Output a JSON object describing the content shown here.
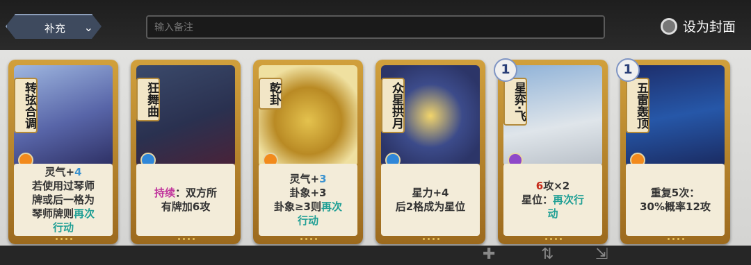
{
  "header": {
    "deck_label": "补充",
    "note_placeholder": "输入备注",
    "cover_label": "设为封面"
  },
  "cards": [
    {
      "name": "转弦合调",
      "gem_color": "#f28a1c",
      "badge": "",
      "desc": [
        [
          "灵气+",
          ""
        ],
        [
          "4",
          "kw-blue"
        ],
        [
          "\n若使用过琴师\n牌或后一格为\n琴师牌则",
          ""
        ],
        [
          "再次\n行动",
          "kw-teal"
        ]
      ]
    },
    {
      "name": "狂舞曲",
      "gem_color": "#2f87d9",
      "badge": "",
      "desc": [
        [
          "持续",
          "kw-pink"
        ],
        [
          "：双方所\n有牌加6攻",
          ""
        ]
      ]
    },
    {
      "name": "乾卦",
      "gem_color": "#f28a1c",
      "badge": "",
      "desc": [
        [
          "灵气+",
          ""
        ],
        [
          "3",
          "kw-blue"
        ],
        [
          "\n卦象+3\n卦象≥3则",
          ""
        ],
        [
          "再次\n行动",
          "kw-teal"
        ]
      ]
    },
    {
      "name": "众星拱月",
      "gem_color": "#2f87d9",
      "badge": "",
      "desc": [
        [
          "星力+4\n后2格成为星位",
          ""
        ]
      ]
    },
    {
      "name": "星弈·飞",
      "gem_color": "#8e48c9",
      "badge": "1",
      "desc": [
        [
          "6",
          "kw-red"
        ],
        [
          "攻×2\n星位：",
          ""
        ],
        [
          "再次行\n动",
          "kw-teal"
        ]
      ]
    },
    {
      "name": "五雷轰顶",
      "gem_color": "#f28a1c",
      "badge": "1",
      "desc": [
        [
          "重复5次：\n30%概率12攻",
          ""
        ]
      ]
    }
  ]
}
